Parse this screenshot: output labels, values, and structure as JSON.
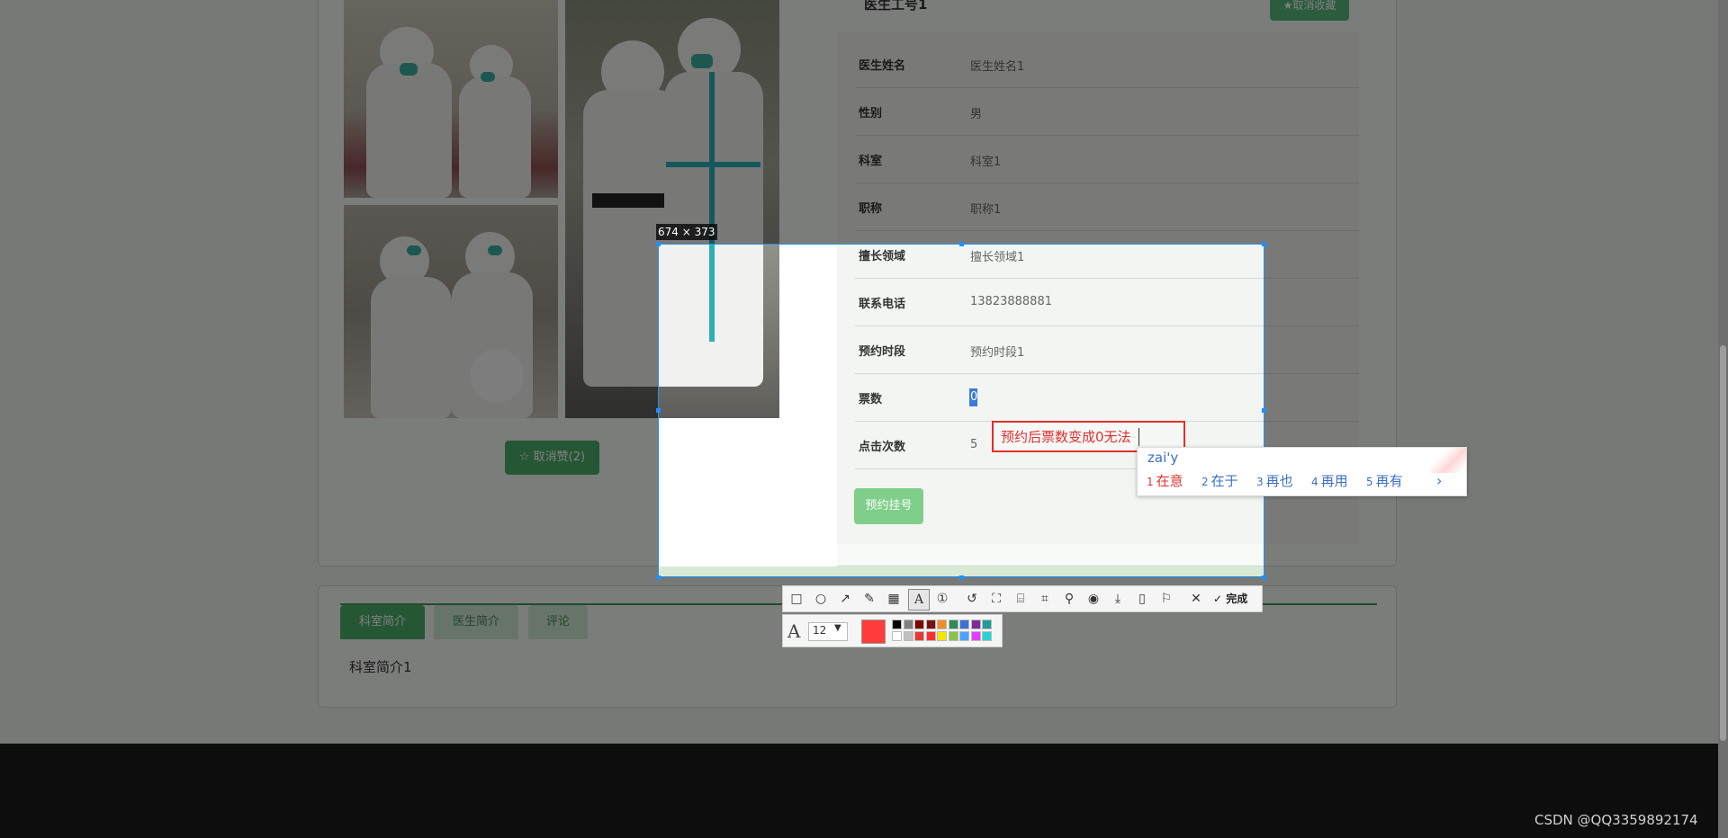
{
  "doctor": {
    "name_heading": "医生工号1",
    "collect_button": "★取消收藏",
    "rows": [
      {
        "label": "医生姓名",
        "value": "医生姓名1"
      },
      {
        "label": "性别",
        "value": "男"
      },
      {
        "label": "科室",
        "value": "科室1"
      },
      {
        "label": "职称",
        "value": "职称1"
      },
      {
        "label": "擅长领域",
        "value": "擅长领域1"
      },
      {
        "label": "联系电话",
        "value": "13823888881"
      },
      {
        "label": "预约时段",
        "value": "预约时段1"
      },
      {
        "label": "票数",
        "value": "0"
      },
      {
        "label": "点击次数",
        "value": "5"
      }
    ],
    "book_button": "预约挂号",
    "unfavorite_button": "☆ 取消赞(2)"
  },
  "tabs": [
    {
      "label": "科室简介",
      "active": true
    },
    {
      "label": "医生简介",
      "active": false
    },
    {
      "label": "评论",
      "active": false
    }
  ],
  "tab_content": "科室简介1",
  "screenshot_tool": {
    "size_label": "674 × 373",
    "annotation_text": "预约后票数变成0无法",
    "toolbar": {
      "done_label": "完成",
      "icons": [
        "rectangle-icon",
        "ellipse-icon",
        "arrow-icon",
        "pen-icon",
        "mosaic-icon",
        "text-icon",
        "number-icon",
        "undo-icon",
        "ocr-icon",
        "translate-icon",
        "scan-icon",
        "pin-icon",
        "record-icon",
        "download-icon",
        "save-icon",
        "bookmark-icon",
        "close-icon",
        "check-icon"
      ]
    },
    "text_options": {
      "font_size": "12",
      "current_color": "#ff3b3b",
      "palette_top": [
        "#000000",
        "#808080",
        "#800000",
        "#7a1010",
        "#f28c28",
        "#2e8b57",
        "#3f6fd8",
        "#7d2a9c",
        "#1e9c9c"
      ],
      "palette_bottom": [
        "#ffffff",
        "#c0c0c0",
        "#e53935",
        "#ff2d2d",
        "#f5e600",
        "#8bc34a",
        "#4aa3ff",
        "#e040fb",
        "#26d4d4"
      ]
    }
  },
  "ime": {
    "input": "zai'y",
    "candidates": [
      {
        "num": "1",
        "text": "在意"
      },
      {
        "num": "2",
        "text": "在于"
      },
      {
        "num": "3",
        "text": "再也"
      },
      {
        "num": "4",
        "text": "再用"
      },
      {
        "num": "5",
        "text": "再有"
      }
    ],
    "next_label": "›"
  },
  "watermark": "CSDN @QQ3359892174"
}
